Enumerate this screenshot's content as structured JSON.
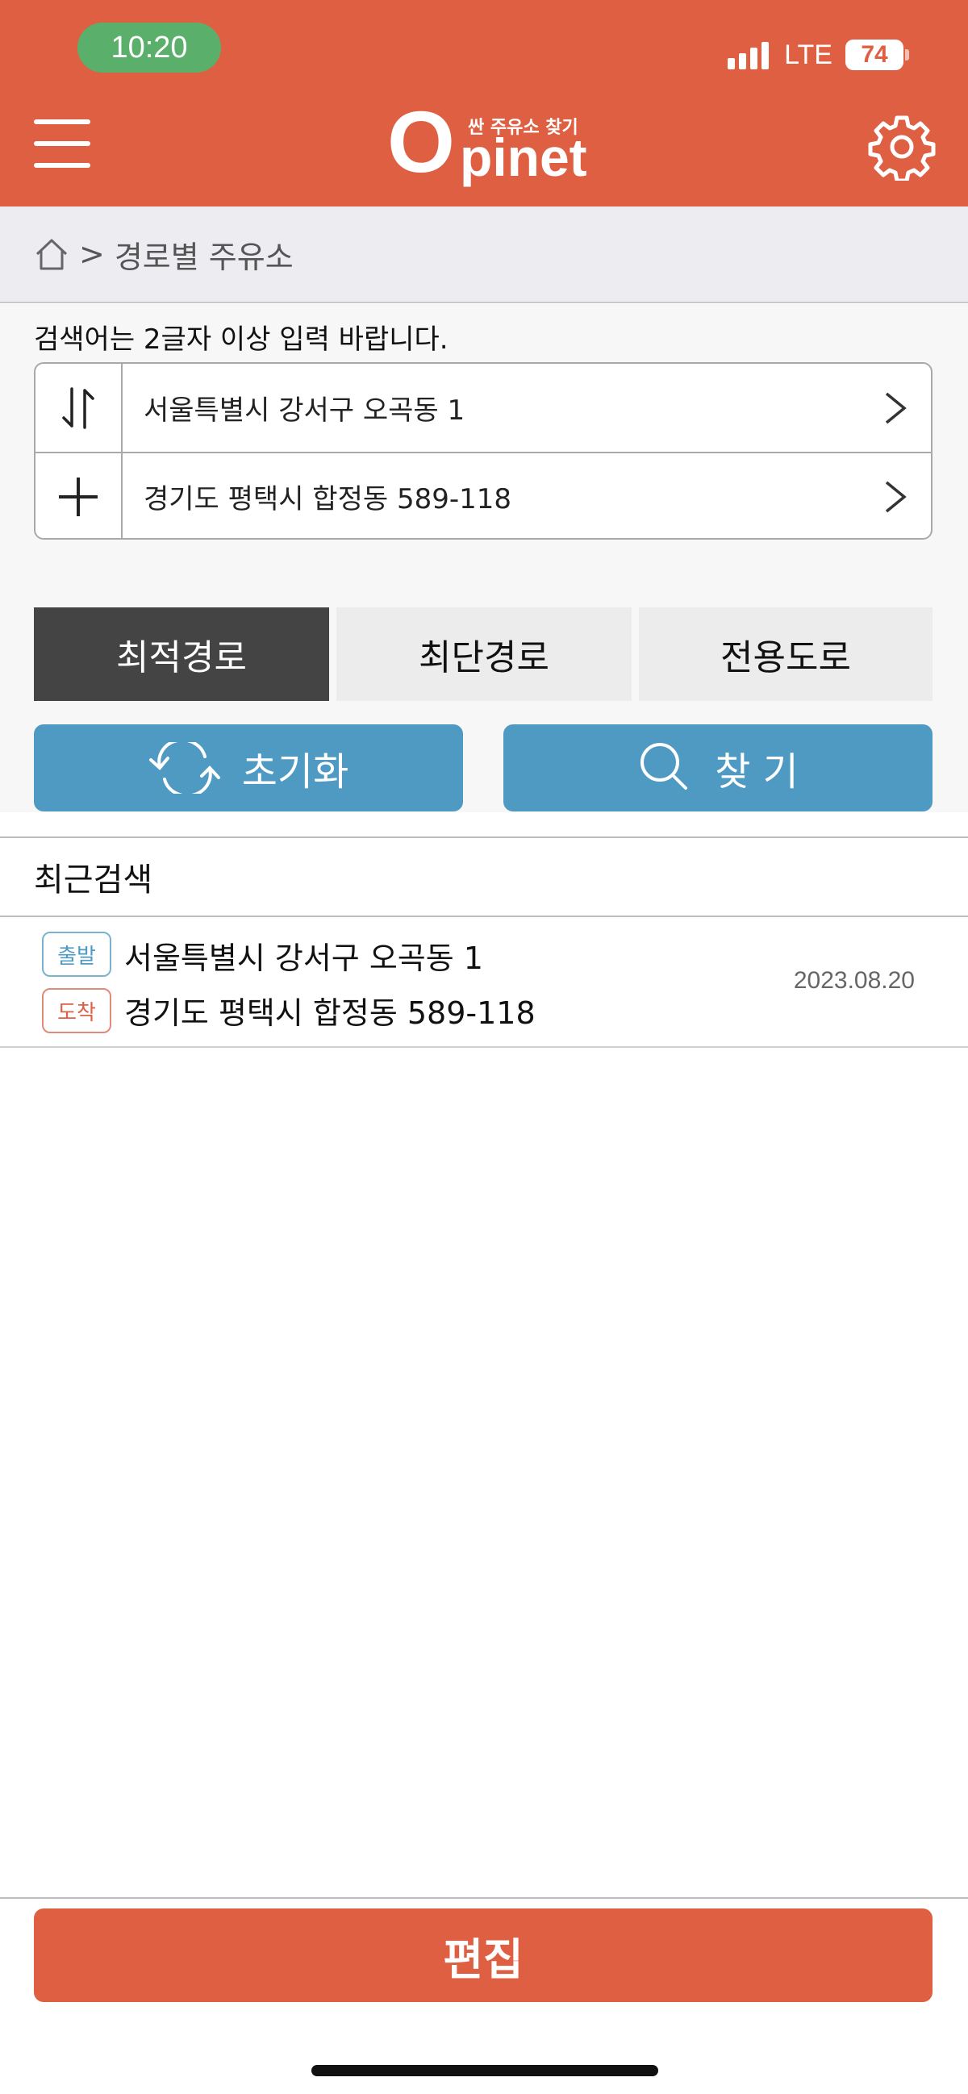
{
  "status_bar": {
    "time": "10:20",
    "network": "LTE",
    "battery": "74"
  },
  "header": {
    "logo_main_initial": "O",
    "logo_main_rest": "pinet",
    "logo_sub": "싼 주유소 찾기",
    "brand_color": "#df5f43"
  },
  "breadcrumb": {
    "separator": ">",
    "label": "경로별 주유소"
  },
  "search": {
    "hint": "검색어는 2글자 이상 입력 바랍니다.",
    "origin": "서울특별시 강서구 오곡동 1",
    "destination": "경기도 평택시 합정동 589-118",
    "swap_icon": "swap-vertical-icon",
    "add_icon": "plus-icon"
  },
  "tabs": [
    {
      "label": "최적경로",
      "active": true
    },
    {
      "label": "최단경로",
      "active": false
    },
    {
      "label": "전용도로",
      "active": false
    }
  ],
  "actions": {
    "reset_label": "초기화",
    "find_label": "찾 기",
    "button_color": "#4f9ac3"
  },
  "recent": {
    "title": "최근검색",
    "items": [
      {
        "start_badge": "출발",
        "start": "서울특별시 강서구 오곡동 1",
        "end_badge": "도착",
        "end": "경기도 평택시 합정동 589-118",
        "date": "2023.08.20"
      }
    ]
  },
  "footer": {
    "edit_label": "편집"
  }
}
